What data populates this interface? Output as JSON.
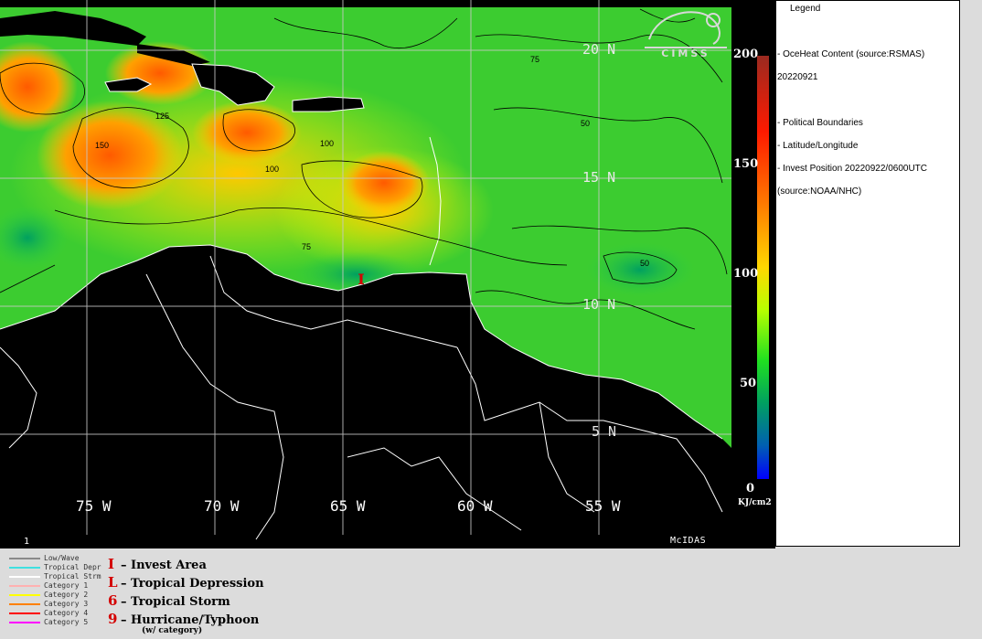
{
  "map": {
    "longitude_labels": [
      "75 W",
      "70 W",
      "65 W",
      "60 W",
      "55 W"
    ],
    "latitude_labels": [
      "20 N",
      "15 N",
      "10 N",
      "5 N"
    ],
    "frame_number": "1",
    "software": "McIDAS",
    "logo_text": "CIMSS",
    "contour_labels": [
      "150",
      "125",
      "100",
      "75",
      "50"
    ],
    "land_color": "#000000"
  },
  "scale": {
    "ticks": [
      "200",
      "150",
      "100",
      "50",
      "0"
    ],
    "units": "KJ/cm2"
  },
  "legend": {
    "title": "Legend",
    "product": "-  OceHeat Content  (source:RSMAS)",
    "date": "20220921",
    "boundaries": "-  Political Boundaries",
    "latlon": "-  Latitude/Longitude",
    "invest": "-  Invest Position  20220922/0600UTC",
    "invest_source": "(source:NOAA/NHC)"
  },
  "track_key": {
    "items": [
      {
        "label": "Low/Wave",
        "color": "#8a8a8a"
      },
      {
        "label": "Tropical Depr",
        "color": "#40e0e0"
      },
      {
        "label": "Tropical Strm",
        "color": "#ffffff"
      },
      {
        "label": "Category 1",
        "color": "#ffb0b0"
      },
      {
        "label": "Category 2",
        "color": "#ffff00"
      },
      {
        "label": "Category 3",
        "color": "#ff8000"
      },
      {
        "label": "Category 4",
        "color": "#ff0000"
      },
      {
        "label": "Category 5",
        "color": "#ff00ff"
      }
    ]
  },
  "symbol_key": {
    "items": [
      {
        "symbol": "I",
        "label": "– Invest Area"
      },
      {
        "symbol": "L",
        "label": "– Tropical Depression"
      },
      {
        "symbol": "6",
        "label": "– Tropical Storm"
      },
      {
        "symbol": "9",
        "label": "– Hurricane/Typhoon"
      }
    ],
    "note": "(w/ category)"
  },
  "invest_marker": "I"
}
